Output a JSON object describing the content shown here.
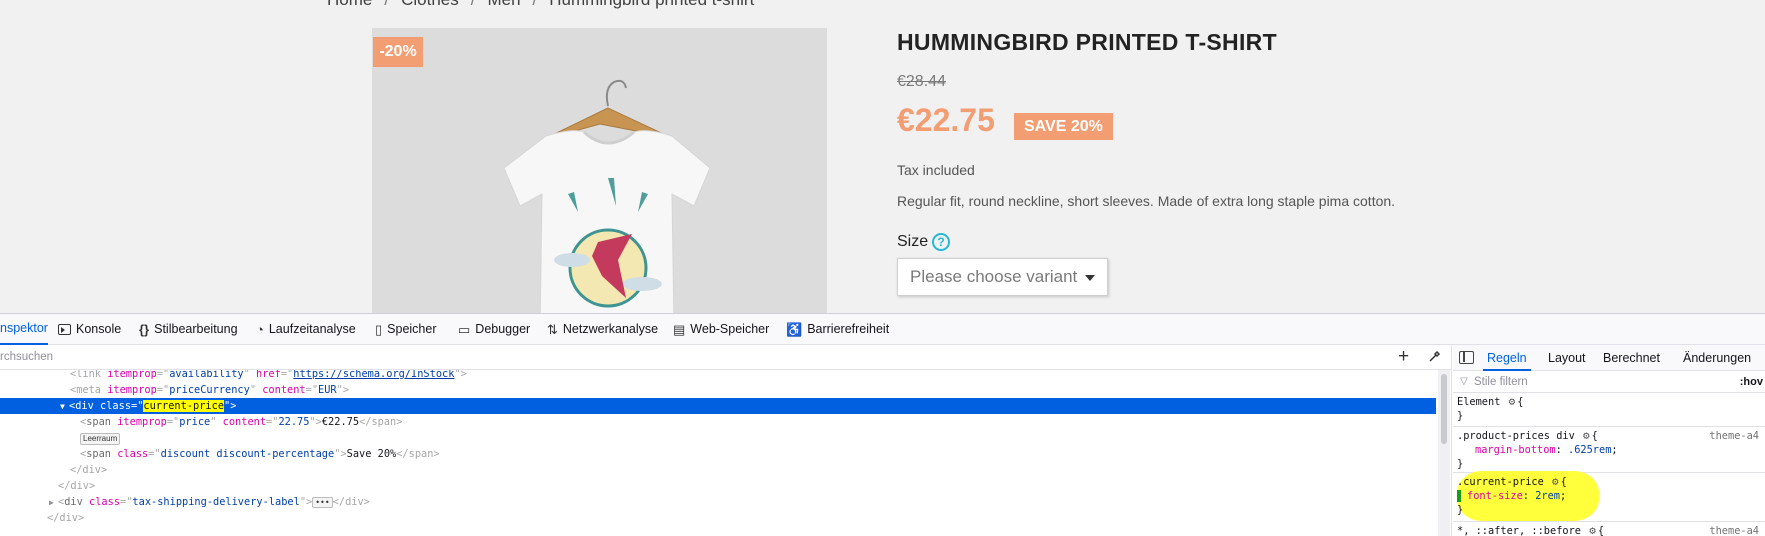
{
  "page": {
    "breadcrumb": [
      "Home",
      "Clothes",
      "Men",
      "Hummingbird printed t-shirt"
    ],
    "breadcrumb_separator": "/",
    "discount_flag": "-20%",
    "product_title": "HUMMINGBIRD PRINTED T-SHIRT",
    "regular_price": "€28.44",
    "current_price": "€22.75",
    "save_badge": "SAVE 20%",
    "tax_label": "Tax included",
    "short_description": "Regular fit, round neckline, short sleeves. Made of extra long staple pima cotton.",
    "size_label": "Size",
    "help_icon": "?",
    "variant_select": "Please choose variant",
    "colors": {
      "accent": "#f39d72",
      "help": "#24b9d7",
      "background": "#f1f1f1"
    }
  },
  "devtools": {
    "tabs": [
      {
        "label": "nspektor",
        "icon": "inspector-icon",
        "active": true
      },
      {
        "label": "Konsole",
        "icon": "console-icon"
      },
      {
        "label": "Stilbearbeitung",
        "icon": "braces-icon"
      },
      {
        "label": "Laufzeitanalyse",
        "icon": "gauge-icon"
      },
      {
        "label": "Speicher",
        "icon": "memory-icon"
      },
      {
        "label": "Debugger",
        "icon": "debugger-icon"
      },
      {
        "label": "Netzwerkanalyse",
        "icon": "network-icon"
      },
      {
        "label": "Web-Speicher",
        "icon": "storage-icon"
      },
      {
        "label": "Barrierefreiheit",
        "icon": "accessibility-icon"
      }
    ],
    "search_placeholder": "rchsuchen",
    "add_node": "+",
    "markup": {
      "line1": {
        "open": "<link ",
        "attr1": "itemprop",
        "eq": "=\"",
        "val1": "availability",
        "attr2": "href",
        "val2": "https://schema.org/InStock",
        "close": ">"
      },
      "line2": {
        "open": "<meta ",
        "attr1": "itemprop",
        "val1": "priceCurrency",
        "attr2": "content",
        "val2": "EUR",
        "close": ">"
      },
      "line3": {
        "tag": "div",
        "attr1": "class",
        "val1": "current-price",
        "close": ">"
      },
      "line4": {
        "tag": "span",
        "attr1": "itemprop",
        "val1": "price",
        "attr2": "content",
        "val2": "22.75",
        "text": "€22.75",
        "end": "</span>"
      },
      "line5": {
        "badge": "Leerraum"
      },
      "line6": {
        "tag": "span",
        "attr1": "class",
        "val1": "discount discount-percentage",
        "text": "Save 20%",
        "end": "</span>"
      },
      "line7": {
        "end": "</div>"
      },
      "line8": {
        "end": "</div>"
      },
      "line9": {
        "tag": "div",
        "attr1": "class",
        "val1": "tax-shipping-delivery-label",
        "more": "•••",
        "end": "</div>"
      },
      "line10": {
        "end": "</div>"
      }
    },
    "rules_tabs": [
      "Regeln",
      "Layout",
      "Berechnet",
      "Änderungen"
    ],
    "rules_filter_placeholder": "Stile filtern",
    "hov": ":hov",
    "rules": {
      "element": {
        "selector": "Element",
        "brace_open": "{",
        "brace_close": "}"
      },
      "product_prices": {
        "selector": ".product-prices div",
        "source": "theme-a4",
        "prop": "margin-bottom",
        "value": ".625rem"
      },
      "current_price": {
        "selector": ".current-price",
        "prop": "font-size",
        "value": "2rem"
      },
      "universal": {
        "selector": "*, ::after, ::before",
        "source": "theme-a4"
      }
    }
  }
}
